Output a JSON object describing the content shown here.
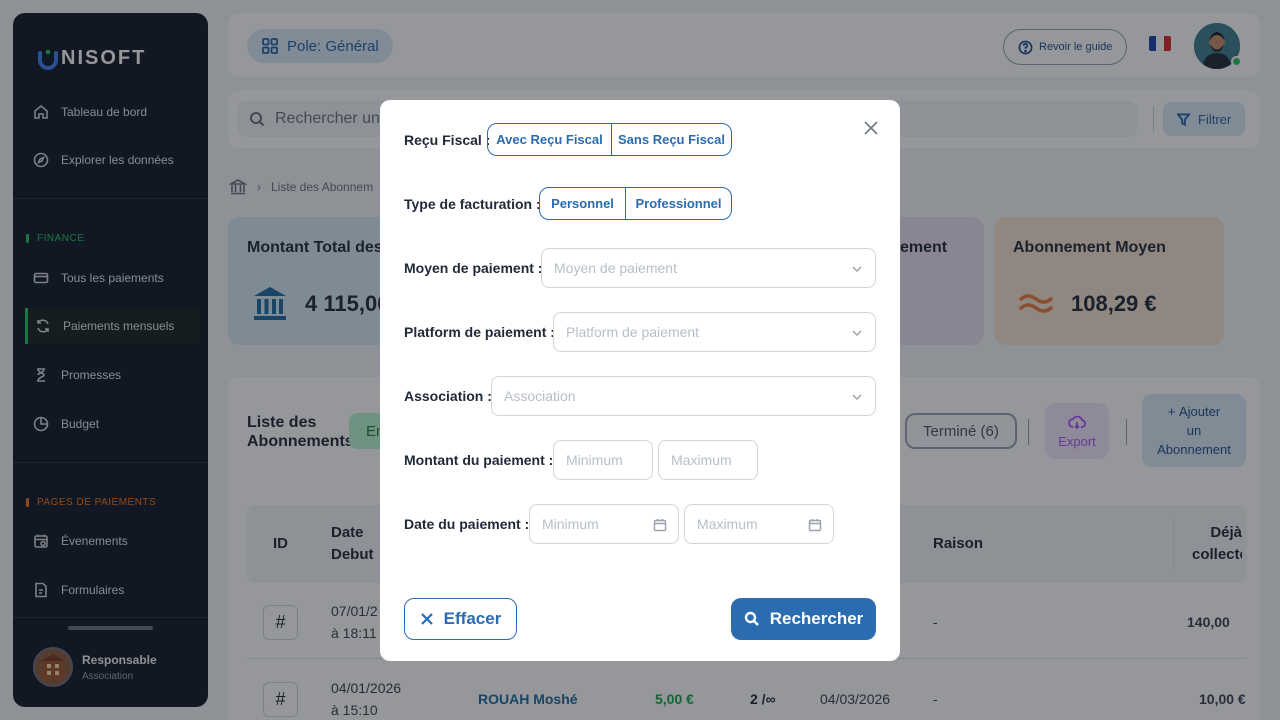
{
  "brand": {
    "name": "NISOFT"
  },
  "sidebar": {
    "items": [
      {
        "label": "Tableau de bord",
        "icon": "home-icon"
      },
      {
        "label": "Explorer les données",
        "icon": "compass-icon"
      },
      {
        "label": "Tous les paiements",
        "icon": "card-icon"
      },
      {
        "label": "Paiements mensuels",
        "icon": "refresh-icon"
      },
      {
        "label": "Promesses",
        "icon": "hourglass-icon"
      },
      {
        "label": "Budget",
        "icon": "pie-icon"
      },
      {
        "label": "Évenements",
        "icon": "calendar-icon"
      },
      {
        "label": "Formulaires",
        "icon": "form-icon"
      }
    ],
    "section_finance": "FINANCE",
    "section_pages": "PAGES DE PAIEMENTS",
    "finance_color": "#22c55e",
    "pages_color": "#f97316",
    "user": {
      "name": "Responsable",
      "role": "Association"
    }
  },
  "topbar": {
    "pole_label": "Pole: Général",
    "guide_label": "Revoir le guide"
  },
  "search": {
    "placeholder": "Rechercher un",
    "filter_label": "Filtrer"
  },
  "breadcrumb": {
    "current": "Liste des Abonnem"
  },
  "cards": [
    {
      "title": "Montant Total des",
      "value": "4 115,00",
      "bg": "#d8e9f4",
      "icon": "bank-icon"
    },
    {
      "title": "ement",
      "bg": "#ecdff3"
    },
    {
      "title": "Abonnement Moyen",
      "value": "108,29 €",
      "bg": "#f6e2d2",
      "icon": "approx-icon"
    }
  ],
  "list": {
    "title_line1": "Liste des",
    "title_line2": "Abonnements",
    "pill_active": "En",
    "pill_done": "Terminé (6)",
    "export_label": "Export",
    "add_line1": "Ajouter",
    "add_line2": "un",
    "add_line3": "Abonnement"
  },
  "table": {
    "headers": {
      "id": "ID",
      "start_line1": "Date",
      "start_line2": "Debut",
      "reason": "Raison",
      "collected_line1": "Déjà",
      "collected_line2": "collecté"
    },
    "rows": [
      {
        "hash": "#",
        "date": "07/01/2",
        "time": "à 18:11",
        "reason": "-",
        "collected": "140,00"
      },
      {
        "hash": "#",
        "date": "04/01/2026",
        "time": "à 15:10",
        "donor": "ROUAH Moshé",
        "amount": "5,00 €",
        "count": "2 /∞",
        "next": "04/03/2026",
        "reason": "-",
        "collected": "10,00 €"
      }
    ]
  },
  "modal": {
    "recu_label": "Reçu Fiscal :",
    "recu_options": [
      "Avec Reçu Fiscal",
      "Sans Reçu Fiscal"
    ],
    "type_label": "Type de facturation :",
    "type_options": [
      "Personnel",
      "Professionnel"
    ],
    "moyen_label": "Moyen de paiement :",
    "moyen_placeholder": "Moyen de paiement",
    "platform_label": "Platform de paiement :",
    "platform_placeholder": "Platform de paiement",
    "association_label": "Association :",
    "association_placeholder": "Association",
    "montant_label": "Montant du paiement :",
    "montant_min": "Minimum",
    "montant_max": "Maximum",
    "date_label": "Date du paiement :",
    "date_min": "Minimum",
    "date_max": "Maximum",
    "clear_label": "Effacer",
    "search_label": "Rechercher"
  }
}
